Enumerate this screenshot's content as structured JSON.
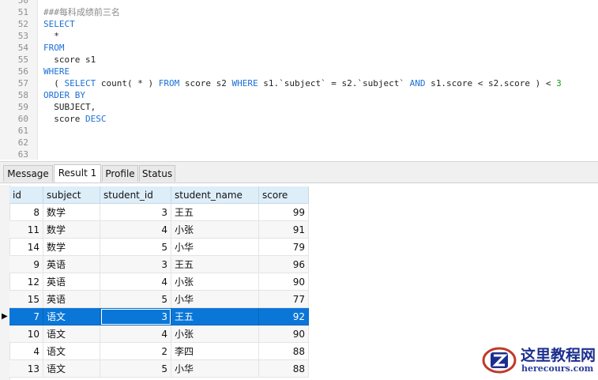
{
  "editor": {
    "lines": [
      {
        "n": "50",
        "t": ""
      },
      {
        "n": "51",
        "t": "###每科成绩前三名"
      },
      {
        "n": "52",
        "t": "SELECT"
      },
      {
        "n": "53",
        "t": "  *"
      },
      {
        "n": "54",
        "t": "FROM"
      },
      {
        "n": "55",
        "t": "  score s1"
      },
      {
        "n": "56",
        "t": "WHERE"
      },
      {
        "n": "57",
        "t": "  ( SELECT count( * ) FROM score s2 WHERE s1.`subject` = s2.`subject` AND s1.score < s2.score ) < 3"
      },
      {
        "n": "58",
        "t": "ORDER BY"
      },
      {
        "n": "59",
        "t": "  SUBJECT,"
      },
      {
        "n": "60",
        "t": "  score DESC"
      },
      {
        "n": "61",
        "t": ""
      },
      {
        "n": "62",
        "t": ""
      },
      {
        "n": "63",
        "t": ""
      }
    ]
  },
  "tabs": [
    "Message",
    "Result 1",
    "Profile",
    "Status"
  ],
  "active_tab": "Result 1",
  "grid": {
    "columns": [
      "id",
      "subject",
      "student_id",
      "student_name",
      "score"
    ],
    "rows": [
      [
        "8",
        "数学",
        "3",
        "王五",
        "99"
      ],
      [
        "11",
        "数学",
        "4",
        "小张",
        "91"
      ],
      [
        "14",
        "数学",
        "5",
        "小华",
        "79"
      ],
      [
        "9",
        "英语",
        "3",
        "王五",
        "96"
      ],
      [
        "12",
        "英语",
        "4",
        "小张",
        "90"
      ],
      [
        "15",
        "英语",
        "5",
        "小华",
        "77"
      ],
      [
        "7",
        "语文",
        "3",
        "王五",
        "92"
      ],
      [
        "10",
        "语文",
        "4",
        "小张",
        "90"
      ],
      [
        "4",
        "语文",
        "2",
        "李四",
        "88"
      ],
      [
        "13",
        "语文",
        "5",
        "小华",
        "88"
      ]
    ],
    "selected_row": 6
  },
  "watermark": {
    "title": "这里教程网",
    "url": "herecours.com"
  },
  "colors": {
    "keyword": "#1c6fd6",
    "selection": "#0a77d8",
    "header_bg": "#ddeef9"
  }
}
